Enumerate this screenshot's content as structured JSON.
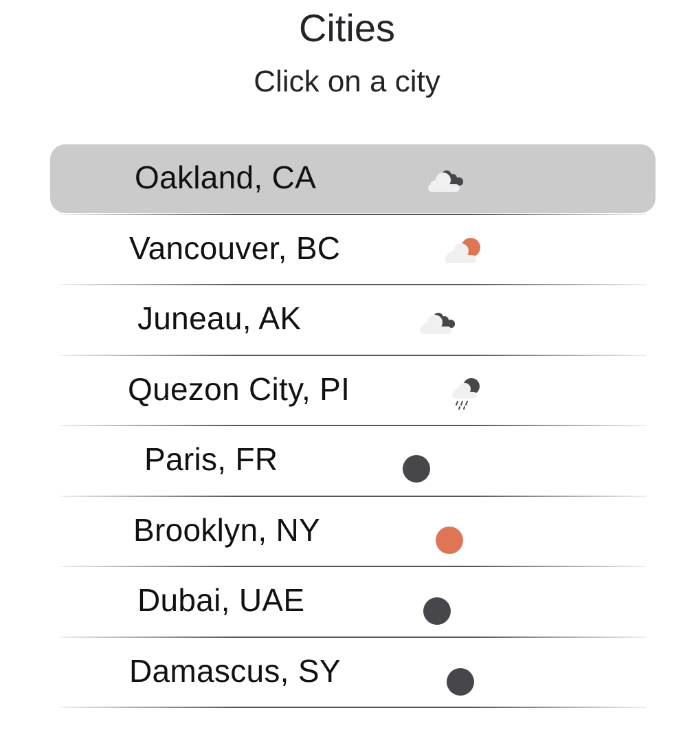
{
  "header": {
    "title": "Cities",
    "subtitle": "Click on a city"
  },
  "colors": {
    "selected_bg": "#cbcbcb",
    "dark_icon": "#47474b",
    "sun_orange": "#e07556",
    "cloud_light": "#f0f0f0"
  },
  "cities": [
    {
      "name": "Oakland, CA",
      "icon": "cloudy-night-icon",
      "selected": true
    },
    {
      "name": "Vancouver, BC",
      "icon": "partly-cloudy-day-icon",
      "selected": false
    },
    {
      "name": "Juneau, AK",
      "icon": "cloudy-night-icon",
      "selected": false
    },
    {
      "name": "Quezon City, PI",
      "icon": "rain-night-icon",
      "selected": false
    },
    {
      "name": "Paris, FR",
      "icon": "clear-night-icon",
      "selected": false
    },
    {
      "name": "Brooklyn, NY",
      "icon": "clear-day-icon",
      "selected": false
    },
    {
      "name": "Dubai, UAE",
      "icon": "clear-night-icon",
      "selected": false
    },
    {
      "name": "Damascus, SY",
      "icon": "clear-night-icon",
      "selected": false
    }
  ]
}
